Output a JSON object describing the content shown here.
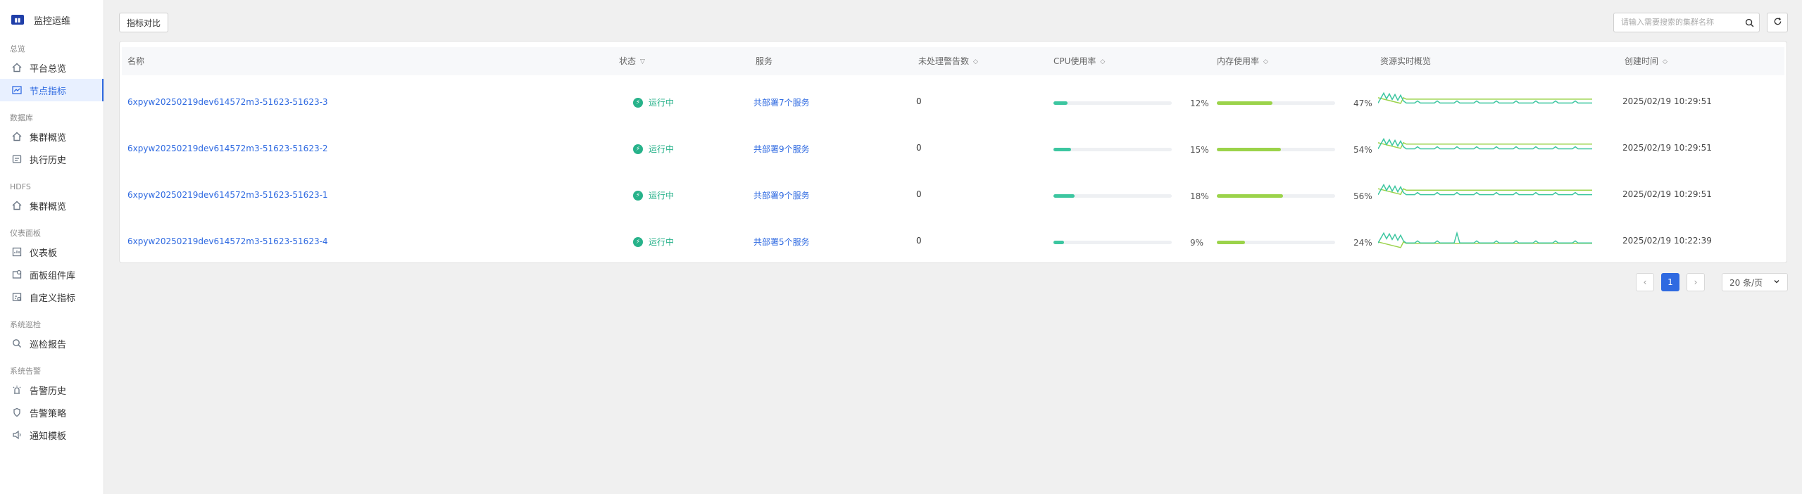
{
  "sidebar": {
    "brand": "监控运维",
    "groups": [
      {
        "label": "总览",
        "items": [
          {
            "label": "平台总览",
            "icon": "home-icon"
          },
          {
            "label": "节点指标",
            "icon": "chart-icon",
            "active": true
          }
        ]
      },
      {
        "label": "数据库",
        "items": [
          {
            "label": "集群概览",
            "icon": "home-icon"
          },
          {
            "label": "执行历史",
            "icon": "history-icon"
          }
        ]
      },
      {
        "label": "HDFS",
        "items": [
          {
            "label": "集群概览",
            "icon": "home-icon"
          }
        ]
      },
      {
        "label": "仪表面板",
        "items": [
          {
            "label": "仪表板",
            "icon": "dashboard-icon"
          },
          {
            "label": "面板组件库",
            "icon": "component-icon"
          },
          {
            "label": "自定义指标",
            "icon": "custom-metric-icon"
          }
        ]
      },
      {
        "label": "系统巡检",
        "items": [
          {
            "label": "巡检报告",
            "icon": "search-report-icon"
          }
        ]
      },
      {
        "label": "系统告警",
        "items": [
          {
            "label": "告警历史",
            "icon": "alarm-history-icon"
          },
          {
            "label": "告警策略",
            "icon": "shield-icon"
          },
          {
            "label": "通知模板",
            "icon": "speaker-icon"
          }
        ]
      }
    ]
  },
  "toolbar": {
    "compare_label": "指标对比",
    "search_placeholder": "请输入需要搜索的集群名称"
  },
  "table": {
    "headers": {
      "name": "名称",
      "status": "状态",
      "service": "服务",
      "alerts": "未处理警告数",
      "cpu": "CPU使用率",
      "mem": "内存使用率",
      "resource": "资源实时概览",
      "created": "创建时间"
    },
    "rows": [
      {
        "name": "6xpyw20250219dev614572m3-51623-51623-3",
        "status": "运行中",
        "service": "共部署7个服务",
        "alerts": "0",
        "cpu": 0.12,
        "cpu_label": "12%",
        "mem": 0.47,
        "mem_label": "47%",
        "created": "2025/02/19 10:29:51"
      },
      {
        "name": "6xpyw20250219dev614572m3-51623-51623-2",
        "status": "运行中",
        "service": "共部署9个服务",
        "alerts": "0",
        "cpu": 0.15,
        "cpu_label": "15%",
        "mem": 0.54,
        "mem_label": "54%",
        "created": "2025/02/19 10:29:51"
      },
      {
        "name": "6xpyw20250219dev614572m3-51623-51623-1",
        "status": "运行中",
        "service": "共部署9个服务",
        "alerts": "0",
        "cpu": 0.18,
        "cpu_label": "18%",
        "mem": 0.56,
        "mem_label": "56%",
        "created": "2025/02/19 10:29:51"
      },
      {
        "name": "6xpyw20250219dev614572m3-51623-51623-4",
        "status": "运行中",
        "service": "共部署5个服务",
        "alerts": "0",
        "cpu": 0.09,
        "cpu_label": "9%",
        "mem": 0.24,
        "mem_label": "24%",
        "created": "2025/02/19 10:22:39"
      }
    ]
  },
  "pagination": {
    "current": "1",
    "page_size": "20 条/页"
  },
  "colors": {
    "accent": "#2f6ae1",
    "cpu_bar": "#3cc6a0",
    "mem_bar": "#9bd34a",
    "running": "#27b28a"
  }
}
